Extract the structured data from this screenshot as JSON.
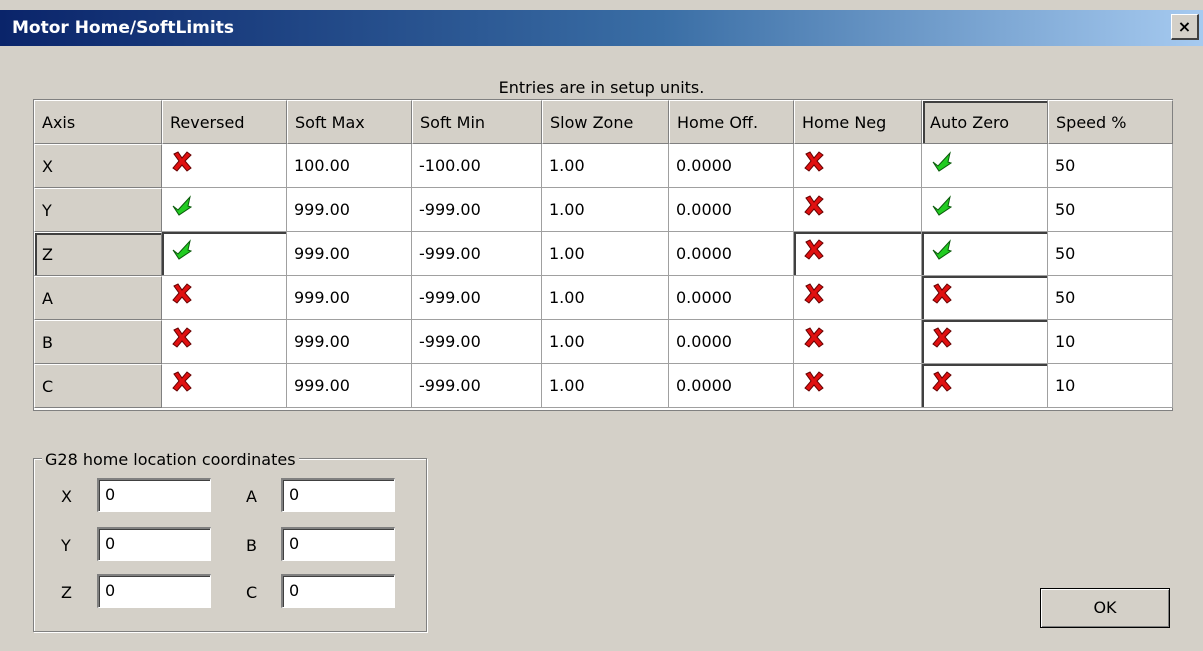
{
  "window": {
    "title": "Motor Home/SoftLimits",
    "close_label": "×"
  },
  "caption": "Entries are in setup units.",
  "table": {
    "columns": [
      "Axis",
      "Reversed",
      "Soft Max",
      "Soft Min",
      "Slow Zone",
      "Home Off.",
      "Home Neg",
      "Auto Zero",
      "Speed %"
    ],
    "rows": [
      {
        "axis": "X",
        "reversed": false,
        "soft_max": "100.00",
        "soft_min": "-100.00",
        "slow_zone": "1.00",
        "home_off": "0.0000",
        "home_neg": false,
        "auto_zero": true,
        "speed": "50"
      },
      {
        "axis": "Y",
        "reversed": true,
        "soft_max": "999.00",
        "soft_min": "-999.00",
        "slow_zone": "1.00",
        "home_off": "0.0000",
        "home_neg": false,
        "auto_zero": true,
        "speed": "50"
      },
      {
        "axis": "Z",
        "reversed": true,
        "soft_max": "999.00",
        "soft_min": "-999.00",
        "slow_zone": "1.00",
        "home_off": "0.0000",
        "home_neg": false,
        "auto_zero": true,
        "speed": "50"
      },
      {
        "axis": "A",
        "reversed": false,
        "soft_max": "999.00",
        "soft_min": "-999.00",
        "slow_zone": "1.00",
        "home_off": "0.0000",
        "home_neg": false,
        "auto_zero": false,
        "speed": "50"
      },
      {
        "axis": "B",
        "reversed": false,
        "soft_max": "999.00",
        "soft_min": "-999.00",
        "slow_zone": "1.00",
        "home_off": "0.0000",
        "home_neg": false,
        "auto_zero": false,
        "speed": "10"
      },
      {
        "axis": "C",
        "reversed": false,
        "soft_max": "999.00",
        "soft_min": "-999.00",
        "slow_zone": "1.00",
        "home_off": "0.0000",
        "home_neg": false,
        "auto_zero": false,
        "speed": "10"
      }
    ]
  },
  "g28": {
    "label": "G28 home location coordinates",
    "fields": [
      {
        "label": "X",
        "value": "0"
      },
      {
        "label": "A",
        "value": "0"
      },
      {
        "label": "Y",
        "value": "0"
      },
      {
        "label": "B",
        "value": "0"
      },
      {
        "label": "Z",
        "value": "0"
      },
      {
        "label": "C",
        "value": "0"
      }
    ]
  },
  "ok_label": "OK",
  "icons": {
    "check": "green-check-icon",
    "cross": "red-x-icon"
  },
  "colors": {
    "titlebar": "#0a246a",
    "check": "#22cc22",
    "cross": "#e01010",
    "face": "#d4d0c8"
  }
}
